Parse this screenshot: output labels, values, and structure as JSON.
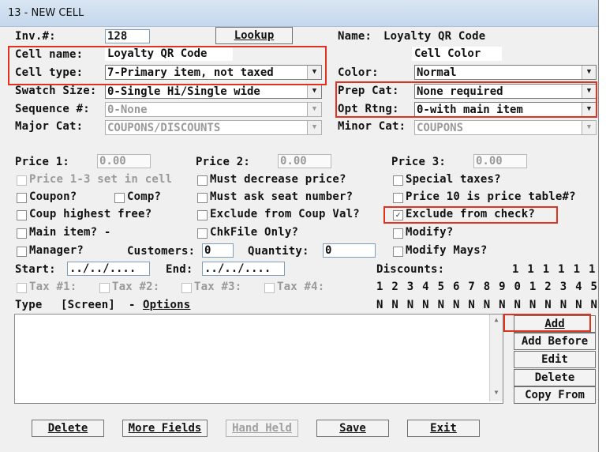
{
  "window": {
    "title": "13 - NEW CELL"
  },
  "inv": {
    "label": "Inv.#:",
    "value": "128",
    "lookup_label": "Lookup"
  },
  "name": {
    "label": "Name:",
    "value": "Loyalty QR Code"
  },
  "cell_color": {
    "label": "Cell Color"
  },
  "cell_name": {
    "label": "Cell name:",
    "value": "Loyalty QR Code"
  },
  "cell_type": {
    "label": "Cell type:",
    "value": "7-Primary item, not taxed"
  },
  "color": {
    "label": "Color:",
    "value": "Normal"
  },
  "swatch": {
    "label": "Swatch Size:",
    "value": "0-Single Hi/Single wide"
  },
  "prep_cat": {
    "label": "Prep Cat:",
    "value": "None required"
  },
  "sequence": {
    "label": "Sequence #:",
    "value": "0-None"
  },
  "opt_rtng": {
    "label": "Opt Rtng:",
    "value": "0-with main item"
  },
  "major_cat": {
    "label": "Major Cat:",
    "value": "COUPONS/DISCOUNTS"
  },
  "minor_cat": {
    "label": "Minor Cat:",
    "value": "COUPONS"
  },
  "price1": {
    "label": "Price 1:",
    "value": "0.00"
  },
  "price2": {
    "label": "Price 2:",
    "value": "0.00"
  },
  "price3": {
    "label": "Price 3:",
    "value": "0.00"
  },
  "checks": {
    "price_set": {
      "label": "Price 1-3 set in cell",
      "checked": false
    },
    "must_decrease": {
      "label": "Must decrease price?",
      "checked": false
    },
    "special_taxes": {
      "label": "Special taxes?",
      "checked": false
    },
    "coupon": {
      "label": "Coupon?",
      "checked": false
    },
    "comp": {
      "label": "Comp?",
      "checked": false
    },
    "must_ask_seat": {
      "label": "Must ask seat number?",
      "checked": false
    },
    "price10": {
      "label": "Price 10 is price table#?",
      "checked": false
    },
    "coup_highest": {
      "label": "Coup highest free?",
      "checked": false
    },
    "exclude_coup": {
      "label": "Exclude from Coup Val?",
      "checked": false
    },
    "exclude_check": {
      "label": "Exclude from check?",
      "checked": true
    },
    "main_item": {
      "label": "Main item? -",
      "checked": false
    },
    "chkfile": {
      "label": "ChkFile Only?",
      "checked": false
    },
    "modify": {
      "label": "Modify?",
      "checked": false
    },
    "manager": {
      "label": "Manager?",
      "checked": false
    },
    "modify_mays": {
      "label": "Modify Mays?",
      "checked": false
    },
    "tax1": {
      "label": "Tax #1:",
      "checked": false
    },
    "tax2": {
      "label": "Tax #2:",
      "checked": false
    },
    "tax3": {
      "label": "Tax #3:",
      "checked": false
    },
    "tax4": {
      "label": "Tax #4:",
      "checked": false
    }
  },
  "customers": {
    "label": "Customers:",
    "value": "0"
  },
  "quantity": {
    "label": "Quantity:",
    "value": "0"
  },
  "start": {
    "label": "Start:",
    "value": "../../...."
  },
  "end": {
    "label": "End:",
    "value": "../../...."
  },
  "discounts": {
    "label": "Discounts:",
    "tens": [
      "1",
      "1",
      "1",
      "1",
      "1",
      "1"
    ],
    "ones": [
      "1",
      "2",
      "3",
      "4",
      "5",
      "6",
      "7",
      "8",
      "9",
      "0",
      "1",
      "2",
      "3",
      "4",
      "5"
    ],
    "flags": [
      "N",
      "N",
      "N",
      "N",
      "N",
      "N",
      "N",
      "N",
      "N",
      "N",
      "N",
      "N",
      "N",
      "N",
      "N"
    ]
  },
  "list_header": {
    "type": "Type",
    "screen": "[Screen]",
    "dash": "-",
    "options": "Options"
  },
  "side_buttons": {
    "add": "Add",
    "add_before": "Add Before",
    "edit": "Edit",
    "delete": "Delete",
    "copy_from": "Copy From"
  },
  "bottom_buttons": {
    "delete": "Delete",
    "more_fields": "More Fields",
    "hand_held": "Hand Held",
    "save": "Save",
    "exit": "Exit"
  },
  "colors": {
    "highlight": "#e0321e",
    "title_bar": "#c4d7ec",
    "dialog": "#f0f0f0"
  }
}
